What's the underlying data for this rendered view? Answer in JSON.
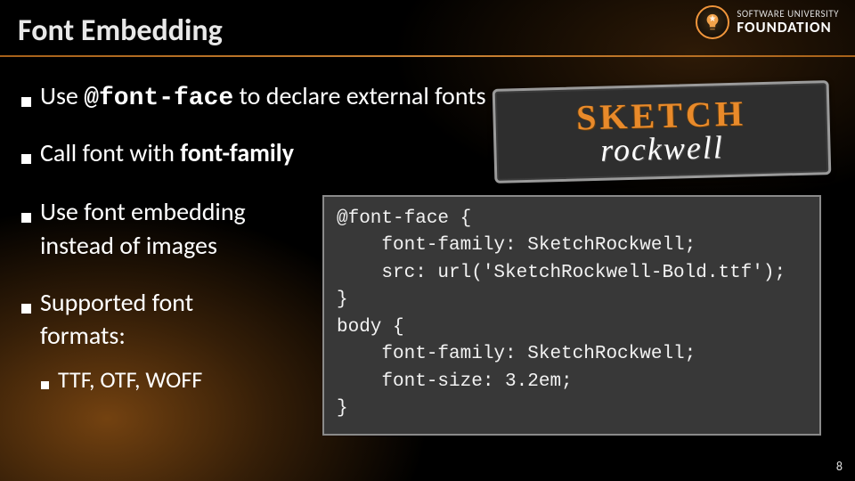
{
  "title": "Font Embedding",
  "logo": {
    "line1": "SOFTWARE UNIVERSITY",
    "line2": "FOUNDATION"
  },
  "bullets": {
    "b1_pre": "Use ",
    "b1_code": "@font-face",
    "b1_post": " to declare external fonts",
    "b2_pre": "Call font with ",
    "b2_bold": "font-family",
    "b3_l1": "Use font embedding",
    "b3_l2": "instead of images",
    "b4_l1": "Supported font",
    "b4_l2": "formats:",
    "b4_sub": "TTF, OTF, WOFF"
  },
  "sketch": {
    "line1": "SKETCH",
    "line2": "rockwell"
  },
  "code": "@font-face {\n    font-family: SketchRockwell;\n    src: url('SketchRockwell-Bold.ttf');\n}\nbody {\n    font-family: SketchRockwell;\n    font-size: 3.2em;\n}",
  "page": "8"
}
